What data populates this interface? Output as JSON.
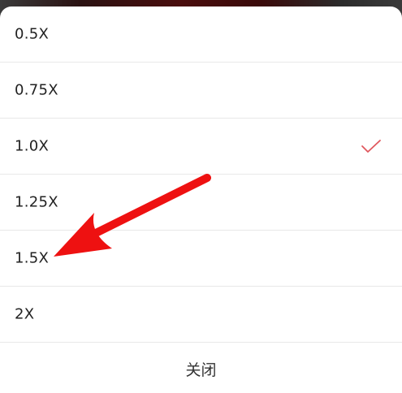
{
  "speed_menu": {
    "items": [
      {
        "label": "0.5X",
        "selected": false
      },
      {
        "label": "0.75X",
        "selected": false
      },
      {
        "label": "1.0X",
        "selected": true
      },
      {
        "label": "1.25X",
        "selected": false
      },
      {
        "label": "1.5X",
        "selected": false
      },
      {
        "label": "2X",
        "selected": false
      }
    ],
    "check_icon": "check-icon",
    "close_label": "关闭"
  },
  "colors": {
    "accent_check": "#e0585e",
    "annotation_arrow": "#ee1111"
  }
}
